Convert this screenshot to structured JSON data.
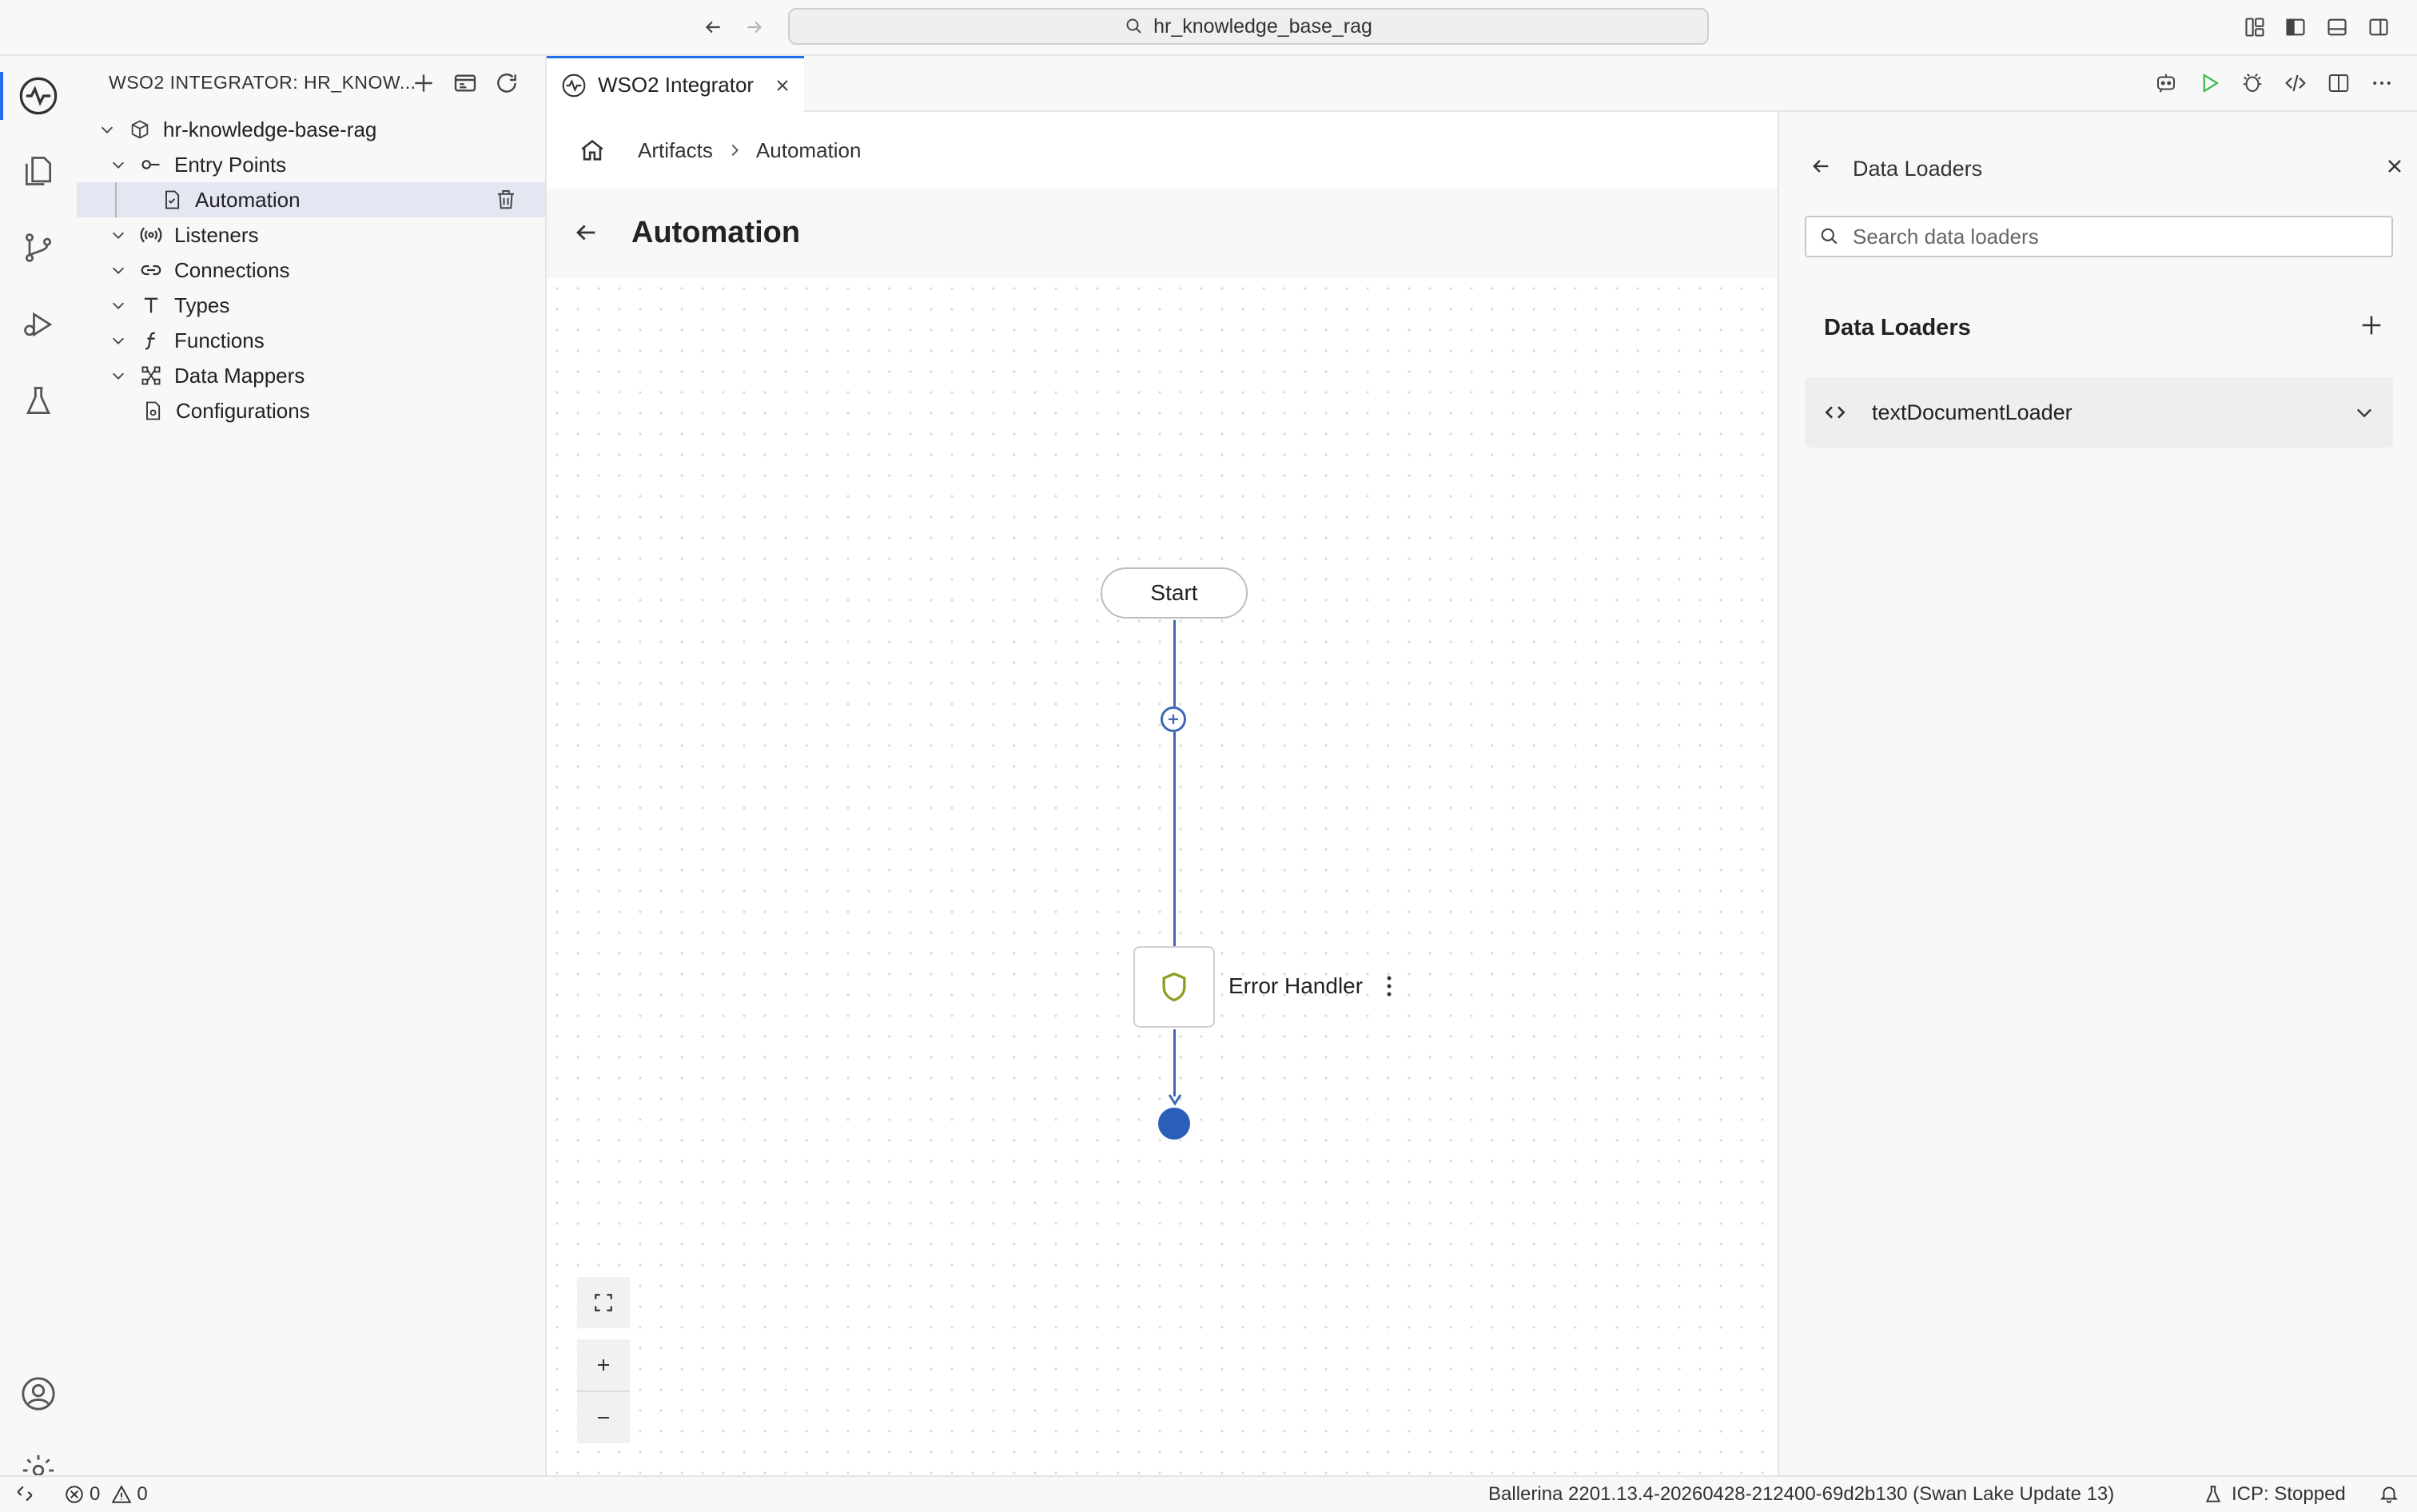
{
  "window": {
    "search_text": "hr_knowledge_base_rag"
  },
  "sidebar": {
    "title": "WSO2 INTEGRATOR: HR_KNOW...",
    "project": "hr-knowledge-base-rag",
    "items": [
      {
        "label": "Entry Points",
        "icon": "entry-points-icon"
      },
      {
        "label": "Automation",
        "icon": "automation-file-icon"
      },
      {
        "label": "Listeners",
        "icon": "listeners-icon"
      },
      {
        "label": "Connections",
        "icon": "link-icon"
      },
      {
        "label": "Types",
        "icon": "type-icon"
      },
      {
        "label": "Functions",
        "icon": "function-icon"
      },
      {
        "label": "Data Mappers",
        "icon": "data-mapper-icon"
      },
      {
        "label": "Configurations",
        "icon": "config-file-icon"
      }
    ]
  },
  "editor": {
    "tab_label": "WSO2 Integrator",
    "breadcrumb": [
      "Artifacts",
      "Automation"
    ],
    "page_title": "Automation"
  },
  "flow": {
    "start_label": "Start",
    "error_handler_label": "Error Handler"
  },
  "panel": {
    "title": "Data Loaders",
    "search_placeholder": "Search data loaders",
    "section_title": "Data Loaders",
    "items": [
      {
        "label": "textDocumentLoader"
      }
    ]
  },
  "status": {
    "errors": "0",
    "warnings": "0",
    "ballerina": "Ballerina 2201.13.4-20260428-212400-69d2b130 (Swan Lake Update 13)",
    "icp": "ICP: Stopped"
  },
  "colors": {
    "accent": "#1f6feb",
    "flow_line": "#3f67b5",
    "end_node": "#2a5fb9",
    "run_green": "#3fb950",
    "shield_olive": "#8f9c1f"
  }
}
